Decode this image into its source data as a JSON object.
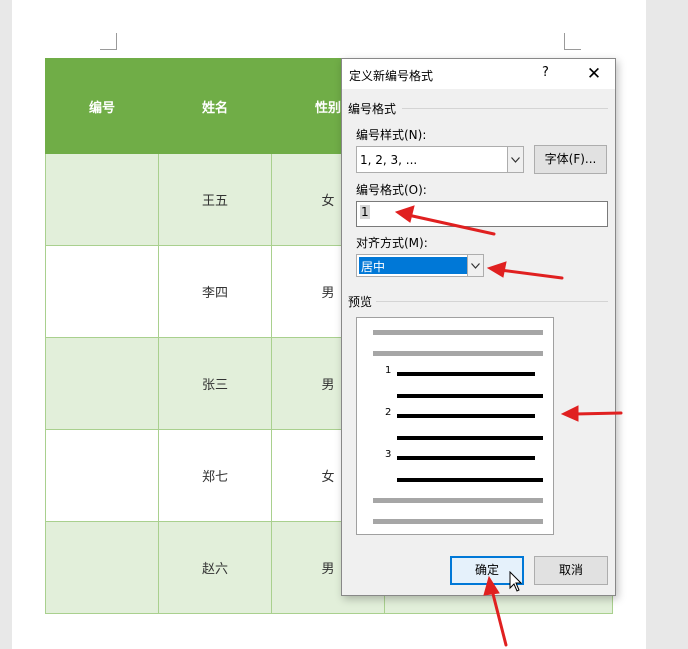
{
  "table": {
    "headers": [
      "编号",
      "姓名",
      "性别",
      ""
    ],
    "rows": [
      [
        "",
        "王五",
        "女",
        ""
      ],
      [
        "",
        "李四",
        "男",
        ""
      ],
      [
        "",
        "张三",
        "男",
        ""
      ],
      [
        "",
        "郑七",
        "女",
        ""
      ],
      [
        "",
        "赵六",
        "男",
        ""
      ]
    ]
  },
  "dialog": {
    "title": "定义新编号格式",
    "help": "?",
    "close": "✕",
    "group_label": "编号格式",
    "style_label": "编号样式(N):",
    "style_value": "1, 2, 3, ...",
    "font_button": "字体(F)...",
    "format_label": "编号格式(O):",
    "format_value": "1",
    "align_label": "对齐方式(M):",
    "align_value": "居中",
    "preview_label": "预览",
    "preview_numbers": [
      "1",
      "2",
      "3"
    ],
    "ok_button": "确定",
    "cancel_button": "取消"
  },
  "colors": {
    "header_green": "#70ad47",
    "band_green": "#e2efda",
    "annotation_red": "#e02020",
    "selection_blue": "#0078d7"
  }
}
